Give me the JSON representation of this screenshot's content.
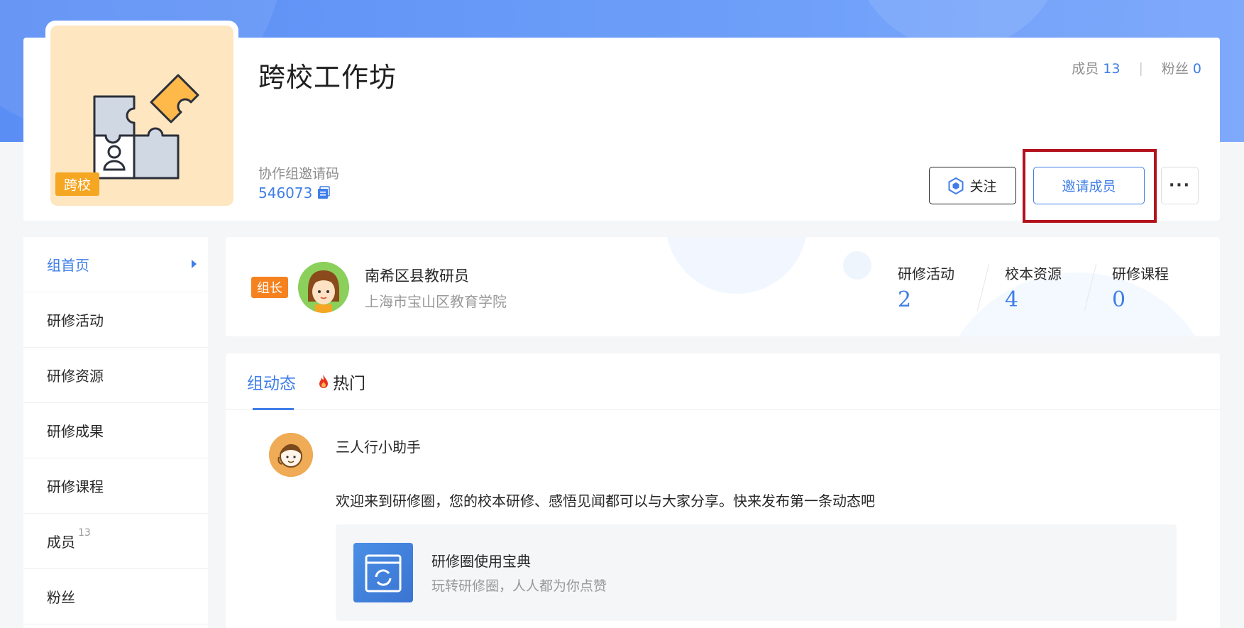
{
  "group": {
    "title": "跨校工作坊",
    "cover_tag": "跨校",
    "invite_code_label": "协作组邀请码",
    "invite_code": "546073",
    "members_label": "成员",
    "members_count": "13",
    "fans_label": "粉丝",
    "fans_count": "0",
    "separator": "|"
  },
  "actions": {
    "follow_label": "关注",
    "invite_label": "邀请成员",
    "more_label": "···"
  },
  "sidebar": {
    "items": [
      {
        "label": "组首页"
      },
      {
        "label": "研修活动"
      },
      {
        "label": "研修资源"
      },
      {
        "label": "研修成果"
      },
      {
        "label": "研修课程"
      },
      {
        "label": "成员",
        "badge": "13"
      },
      {
        "label": "粉丝"
      }
    ]
  },
  "leader": {
    "role_tag": "组长",
    "name": "南希区县教研员",
    "org": "上海市宝山区教育学院",
    "stats": [
      {
        "label": "研修活动",
        "value": "2"
      },
      {
        "label": "校本资源",
        "value": "4"
      },
      {
        "label": "研修课程",
        "value": "0"
      }
    ]
  },
  "feed": {
    "tabs": [
      {
        "label": "组动态"
      },
      {
        "label": "热门"
      }
    ],
    "post": {
      "author": "三人行小助手",
      "text": "欢迎来到研修圈，您的校本研修、感悟见闻都可以与大家分享。快来发布第一条动态吧",
      "card_title": "研修圈使用宝典",
      "card_subtitle": "玩转研修圈，人人都为你点赞"
    }
  },
  "colors": {
    "accent": "#3f7ee8",
    "header_bg": "#5b8ef5",
    "tag_orange": "#f5a623",
    "role_orange": "#f5821f",
    "highlight_red": "#b3121d"
  },
  "icons": {
    "cover": "puzzle-icon",
    "copy": "copy-icon",
    "follow": "hexagon-icon",
    "hot": "flame-icon",
    "guide": "book-refresh-icon"
  }
}
